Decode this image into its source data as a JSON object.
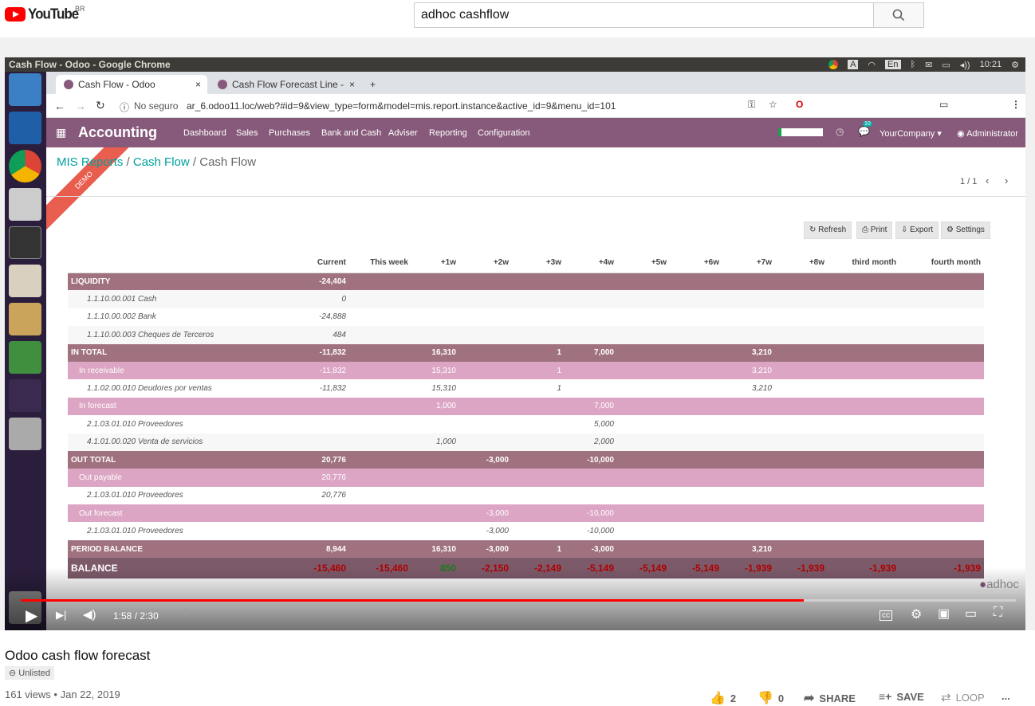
{
  "youtube": {
    "logo_text": "YouTube",
    "country": "BR",
    "search_value": "adhoc cashflow"
  },
  "os": {
    "window_title": "Cash Flow - Odoo - Google Chrome",
    "tray_keyboard": "A",
    "tray_lang": "En",
    "clock": "10:21"
  },
  "browser": {
    "tabs": [
      {
        "label": "Cash Flow - Odoo",
        "close": "×"
      },
      {
        "label": "Cash Flow Forecast Line -",
        "close": "×"
      }
    ],
    "new_tab": "+",
    "security": "No seguro",
    "url": "ar_6.odoo11.loc/web?#id=9&view_type=form&model=mis.report.instance&active_id=9&menu_id=101"
  },
  "odoo": {
    "app": "Accounting",
    "ribbon": "DEMO",
    "menu": [
      "Dashboard",
      "Sales",
      "Purchases",
      "Bank and Cash",
      "Adviser",
      "Reporting",
      "Configuration"
    ],
    "notification_count": "10",
    "company": "YourCompany",
    "user": "Administrator",
    "breadcrumb": [
      "MIS Reports",
      "Cash Flow",
      "Cash Flow"
    ],
    "breadcrumb_sep": "/",
    "pager": "1 / 1",
    "buttons": {
      "refresh": "Refresh",
      "print": "Print",
      "export": "Export",
      "settings": "Settings"
    }
  },
  "report": {
    "columns": [
      "",
      "Current",
      "This week",
      "+1w",
      "+2w",
      "+3w",
      "+4w",
      "+5w",
      "+6w",
      "+7w",
      "+8w",
      "third month",
      "fourth month"
    ],
    "rows": [
      {
        "type": "main",
        "cells": [
          "LIQUIDITY",
          "-24,404",
          "",
          "",
          "",
          "",
          "",
          "",
          "",
          "",
          "",
          "",
          ""
        ]
      },
      {
        "type": "det",
        "cells": [
          "1.1.10.00.001 Cash",
          "0",
          "",
          "",
          "",
          "",
          "",
          "",
          "",
          "",
          "",
          "",
          ""
        ]
      },
      {
        "type": "det",
        "cells": [
          "1.1.10.00.002 Bank",
          "-24,888",
          "",
          "",
          "",
          "",
          "",
          "",
          "",
          "",
          "",
          "",
          ""
        ]
      },
      {
        "type": "det",
        "cells": [
          "1.1.10.00.003 Cheques de Terceros",
          "484",
          "",
          "",
          "",
          "",
          "",
          "",
          "",
          "",
          "",
          "",
          ""
        ]
      },
      {
        "type": "main",
        "cells": [
          "IN TOTAL",
          "-11,832",
          "",
          "16,310",
          "",
          "1",
          "7,000",
          "",
          "",
          "3,210",
          "",
          "",
          ""
        ]
      },
      {
        "type": "sub",
        "cells": [
          "In receivable",
          "-11,832",
          "",
          "15,310",
          "",
          "1",
          "",
          "",
          "",
          "3,210",
          "",
          "",
          ""
        ]
      },
      {
        "type": "det",
        "cells": [
          "1.1.02.00.010 Deudores por ventas",
          "-11,832",
          "",
          "15,310",
          "",
          "1",
          "",
          "",
          "",
          "3,210",
          "",
          "",
          ""
        ]
      },
      {
        "type": "sub",
        "cells": [
          "In forecast",
          "",
          "",
          "1,000",
          "",
          "",
          "7,000",
          "",
          "",
          "",
          "",
          "",
          ""
        ]
      },
      {
        "type": "det",
        "cells": [
          "2.1.03.01.010 Proveedores",
          "",
          "",
          "",
          "",
          "",
          "5,000",
          "",
          "",
          "",
          "",
          "",
          ""
        ]
      },
      {
        "type": "det",
        "cells": [
          "4.1.01.00.020 Venta de servicios",
          "",
          "",
          "1,000",
          "",
          "",
          "2,000",
          "",
          "",
          "",
          "",
          "",
          ""
        ]
      },
      {
        "type": "main",
        "cells": [
          "OUT TOTAL",
          "20,776",
          "",
          "",
          "-3,000",
          "",
          "-10,000",
          "",
          "",
          "",
          "",
          "",
          ""
        ]
      },
      {
        "type": "sub",
        "cells": [
          "Out payable",
          "20,776",
          "",
          "",
          "",
          "",
          "",
          "",
          "",
          "",
          "",
          "",
          ""
        ]
      },
      {
        "type": "det",
        "cells": [
          "2.1.03.01.010 Proveedores",
          "20,776",
          "",
          "",
          "",
          "",
          "",
          "",
          "",
          "",
          "",
          "",
          ""
        ]
      },
      {
        "type": "sub",
        "cells": [
          "Out forecast",
          "",
          "",
          "",
          "-3,000",
          "",
          "-10,000",
          "",
          "",
          "",
          "",
          "",
          ""
        ]
      },
      {
        "type": "det",
        "cells": [
          "2.1.03.01.010 Proveedores",
          "",
          "",
          "",
          "-3,000",
          "",
          "-10,000",
          "",
          "",
          "",
          "",
          "",
          ""
        ]
      },
      {
        "type": "main",
        "cells": [
          "PERIOD BALANCE",
          "8,944",
          "",
          "16,310",
          "-3,000",
          "1",
          "-3,000",
          "",
          "",
          "3,210",
          "",
          "",
          ""
        ]
      },
      {
        "type": "bal",
        "cells": [
          "BALANCE",
          "-15,460",
          "-15,460",
          "850",
          "-2,150",
          "-2,149",
          "-5,149",
          "-5,149",
          "-5,149",
          "-1,939",
          "-1,939",
          "-1,939",
          "-1,939"
        ]
      }
    ]
  },
  "watermark": "adhoc",
  "player": {
    "time": "1:58 / 2:30",
    "progress": 0.787
  },
  "video": {
    "title": "Odoo cash flow forecast",
    "privacy": "Unlisted",
    "meta": "161 views • Jan 22, 2019",
    "likes": "2",
    "dislikes": "0",
    "share": "SHARE",
    "save": "SAVE",
    "loop": "LOOP",
    "more": "..."
  },
  "colors": {
    "odoo_brand": "#875a7b",
    "youtube_red": "#ff0000",
    "positive": "#1a7a1a",
    "negative": "#b00000"
  }
}
